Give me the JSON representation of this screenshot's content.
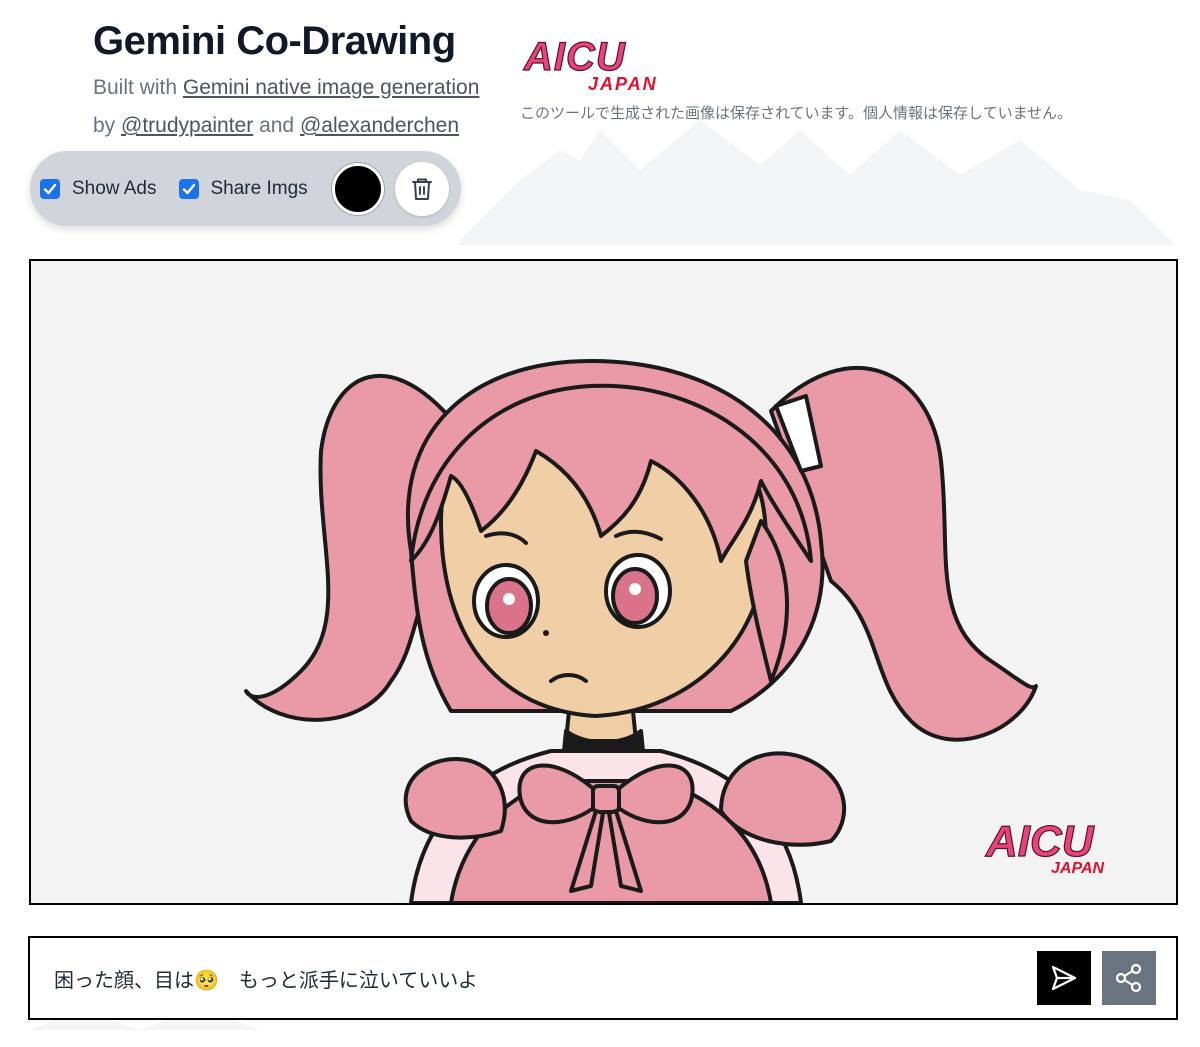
{
  "header": {
    "title": "Gemini Co-Drawing",
    "built_with_prefix": "Built with ",
    "built_with_link": "Gemini native image generation",
    "by_prefix": "by ",
    "author1": "@trudypainter",
    "and_text": " and ",
    "author2": "@alexanderchen"
  },
  "brand": {
    "logo_text": "AICU",
    "logo_subtext": "JAPAN",
    "notice": "このツールで生成された画像は保存されています。個人情報は保存していません。"
  },
  "toolbar": {
    "show_ads_label": "Show Ads",
    "show_ads_checked": true,
    "share_imgs_label": "Share Imgs",
    "share_imgs_checked": true,
    "pen_color": "#000000"
  },
  "canvas": {
    "watermark_text": "AICU",
    "watermark_subtext": "JAPAN"
  },
  "prompt": {
    "value": "困った顔、目は🥺　もっと派手に泣いていいよ"
  },
  "colors": {
    "accent": "#1a73e8",
    "brand_pink": "#e8447a",
    "brand_red": "#e0102f",
    "hair": "#e99aa6",
    "skin": "#f0cfa6"
  }
}
